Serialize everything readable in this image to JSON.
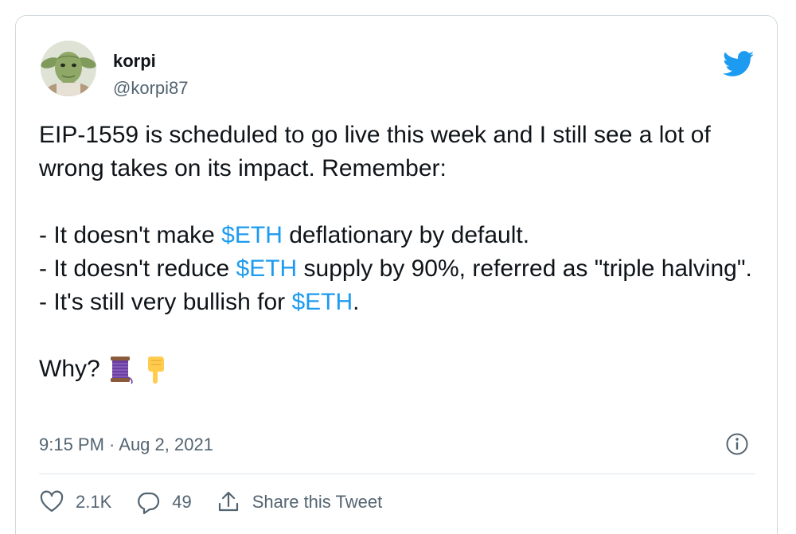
{
  "user": {
    "name": "korpi",
    "handle": "@korpi87"
  },
  "tweet": {
    "line1": "EIP-1559 is scheduled to go live this week and I still see a lot of wrong takes on its impact. Remember:",
    "item1_pre": "- It doesn't make ",
    "item1_tag": "$ETH",
    "item1_post": " deflationary by default.",
    "item2_pre": "- It doesn't reduce ",
    "item2_tag": "$ETH",
    "item2_post": " supply by 90%, referred as \"triple halving\".",
    "item3_pre": "- It's still very bullish for ",
    "item3_tag": "$ETH",
    "item3_post": ".",
    "why": "Why?"
  },
  "meta": {
    "timestamp": "9:15 PM · Aug 2, 2021"
  },
  "actions": {
    "likes": "2.1K",
    "replies": "49",
    "share_label": "Share this Tweet"
  },
  "icons": {
    "twitter_bird": "twitter-bird-icon",
    "info": "info-icon",
    "like": "heart-icon",
    "reply": "reply-bubble-icon",
    "share": "share-icon",
    "thread": "spool-of-thread-icon",
    "point_down": "pointing-down-icon"
  },
  "colors": {
    "link": "#1d9bf0",
    "brand": "#1d9bf0",
    "secondary_text": "#536471",
    "border": "#cfd9de"
  }
}
